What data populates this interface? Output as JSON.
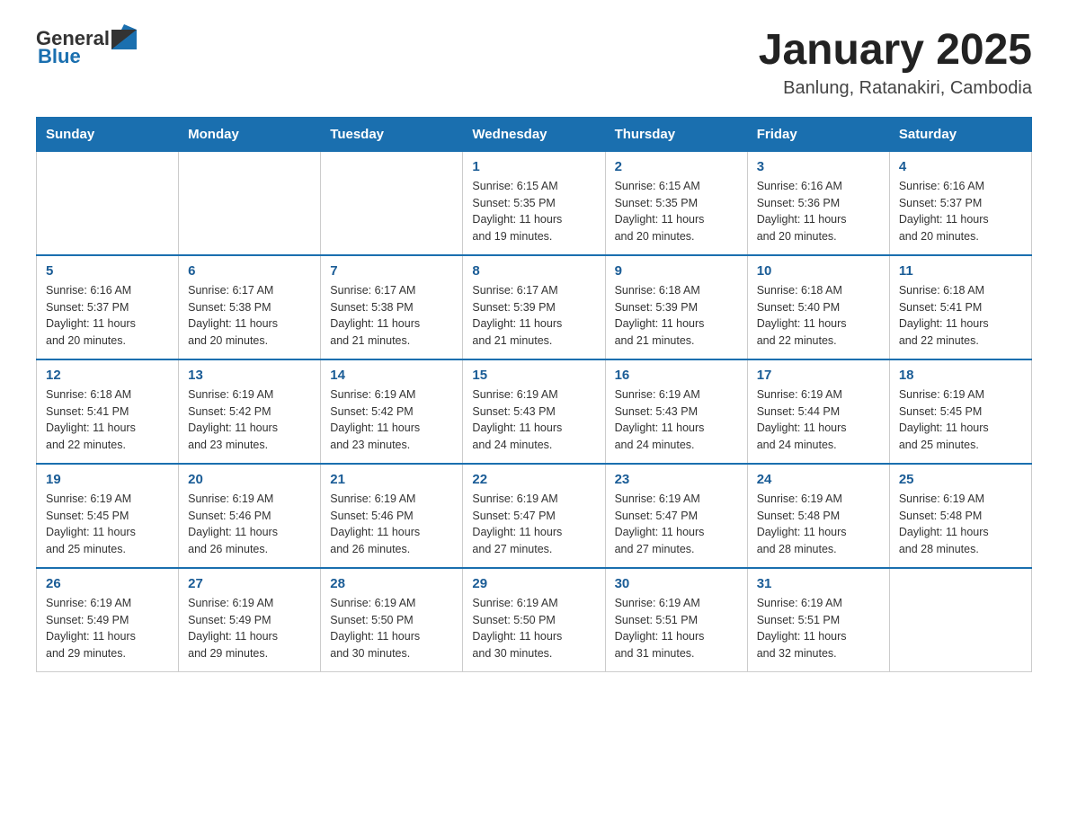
{
  "header": {
    "logo_general": "General",
    "logo_blue": "Blue",
    "month_year": "January 2025",
    "location": "Banlung, Ratanakiri, Cambodia"
  },
  "days_of_week": [
    "Sunday",
    "Monday",
    "Tuesday",
    "Wednesday",
    "Thursday",
    "Friday",
    "Saturday"
  ],
  "weeks": [
    [
      {
        "day": "",
        "info": ""
      },
      {
        "day": "",
        "info": ""
      },
      {
        "day": "",
        "info": ""
      },
      {
        "day": "1",
        "info": "Sunrise: 6:15 AM\nSunset: 5:35 PM\nDaylight: 11 hours\nand 19 minutes."
      },
      {
        "day": "2",
        "info": "Sunrise: 6:15 AM\nSunset: 5:35 PM\nDaylight: 11 hours\nand 20 minutes."
      },
      {
        "day": "3",
        "info": "Sunrise: 6:16 AM\nSunset: 5:36 PM\nDaylight: 11 hours\nand 20 minutes."
      },
      {
        "day": "4",
        "info": "Sunrise: 6:16 AM\nSunset: 5:37 PM\nDaylight: 11 hours\nand 20 minutes."
      }
    ],
    [
      {
        "day": "5",
        "info": "Sunrise: 6:16 AM\nSunset: 5:37 PM\nDaylight: 11 hours\nand 20 minutes."
      },
      {
        "day": "6",
        "info": "Sunrise: 6:17 AM\nSunset: 5:38 PM\nDaylight: 11 hours\nand 20 minutes."
      },
      {
        "day": "7",
        "info": "Sunrise: 6:17 AM\nSunset: 5:38 PM\nDaylight: 11 hours\nand 21 minutes."
      },
      {
        "day": "8",
        "info": "Sunrise: 6:17 AM\nSunset: 5:39 PM\nDaylight: 11 hours\nand 21 minutes."
      },
      {
        "day": "9",
        "info": "Sunrise: 6:18 AM\nSunset: 5:39 PM\nDaylight: 11 hours\nand 21 minutes."
      },
      {
        "day": "10",
        "info": "Sunrise: 6:18 AM\nSunset: 5:40 PM\nDaylight: 11 hours\nand 22 minutes."
      },
      {
        "day": "11",
        "info": "Sunrise: 6:18 AM\nSunset: 5:41 PM\nDaylight: 11 hours\nand 22 minutes."
      }
    ],
    [
      {
        "day": "12",
        "info": "Sunrise: 6:18 AM\nSunset: 5:41 PM\nDaylight: 11 hours\nand 22 minutes."
      },
      {
        "day": "13",
        "info": "Sunrise: 6:19 AM\nSunset: 5:42 PM\nDaylight: 11 hours\nand 23 minutes."
      },
      {
        "day": "14",
        "info": "Sunrise: 6:19 AM\nSunset: 5:42 PM\nDaylight: 11 hours\nand 23 minutes."
      },
      {
        "day": "15",
        "info": "Sunrise: 6:19 AM\nSunset: 5:43 PM\nDaylight: 11 hours\nand 24 minutes."
      },
      {
        "day": "16",
        "info": "Sunrise: 6:19 AM\nSunset: 5:43 PM\nDaylight: 11 hours\nand 24 minutes."
      },
      {
        "day": "17",
        "info": "Sunrise: 6:19 AM\nSunset: 5:44 PM\nDaylight: 11 hours\nand 24 minutes."
      },
      {
        "day": "18",
        "info": "Sunrise: 6:19 AM\nSunset: 5:45 PM\nDaylight: 11 hours\nand 25 minutes."
      }
    ],
    [
      {
        "day": "19",
        "info": "Sunrise: 6:19 AM\nSunset: 5:45 PM\nDaylight: 11 hours\nand 25 minutes."
      },
      {
        "day": "20",
        "info": "Sunrise: 6:19 AM\nSunset: 5:46 PM\nDaylight: 11 hours\nand 26 minutes."
      },
      {
        "day": "21",
        "info": "Sunrise: 6:19 AM\nSunset: 5:46 PM\nDaylight: 11 hours\nand 26 minutes."
      },
      {
        "day": "22",
        "info": "Sunrise: 6:19 AM\nSunset: 5:47 PM\nDaylight: 11 hours\nand 27 minutes."
      },
      {
        "day": "23",
        "info": "Sunrise: 6:19 AM\nSunset: 5:47 PM\nDaylight: 11 hours\nand 27 minutes."
      },
      {
        "day": "24",
        "info": "Sunrise: 6:19 AM\nSunset: 5:48 PM\nDaylight: 11 hours\nand 28 minutes."
      },
      {
        "day": "25",
        "info": "Sunrise: 6:19 AM\nSunset: 5:48 PM\nDaylight: 11 hours\nand 28 minutes."
      }
    ],
    [
      {
        "day": "26",
        "info": "Sunrise: 6:19 AM\nSunset: 5:49 PM\nDaylight: 11 hours\nand 29 minutes."
      },
      {
        "day": "27",
        "info": "Sunrise: 6:19 AM\nSunset: 5:49 PM\nDaylight: 11 hours\nand 29 minutes."
      },
      {
        "day": "28",
        "info": "Sunrise: 6:19 AM\nSunset: 5:50 PM\nDaylight: 11 hours\nand 30 minutes."
      },
      {
        "day": "29",
        "info": "Sunrise: 6:19 AM\nSunset: 5:50 PM\nDaylight: 11 hours\nand 30 minutes."
      },
      {
        "day": "30",
        "info": "Sunrise: 6:19 AM\nSunset: 5:51 PM\nDaylight: 11 hours\nand 31 minutes."
      },
      {
        "day": "31",
        "info": "Sunrise: 6:19 AM\nSunset: 5:51 PM\nDaylight: 11 hours\nand 32 minutes."
      },
      {
        "day": "",
        "info": ""
      }
    ]
  ]
}
